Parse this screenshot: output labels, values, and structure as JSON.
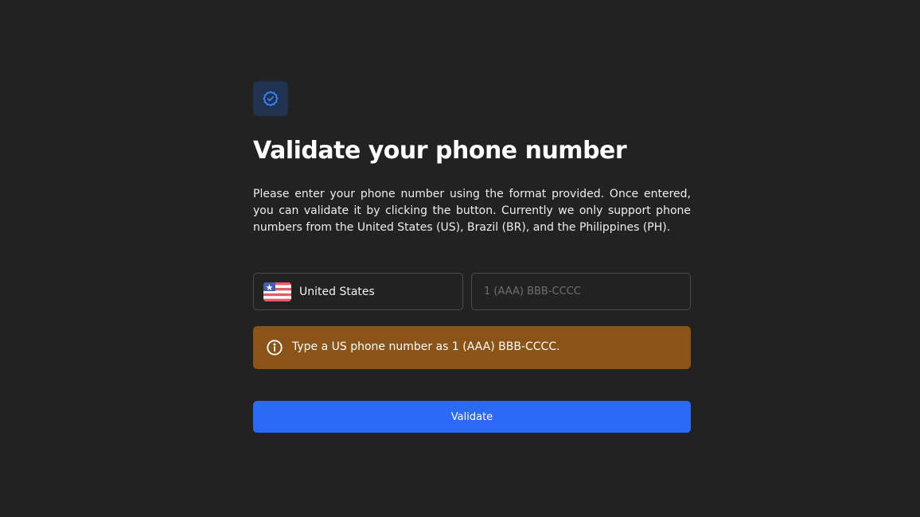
{
  "header": {
    "icon": "verified-badge-icon",
    "title": "Validate your phone number",
    "description": "Please enter your phone number using the format provided. Once entered, you can validate it by clicking the button. Currently we only support phone numbers from the United States (US), Brazil (BR), and the Philippines (PH)."
  },
  "form": {
    "country": {
      "selected_label": "United States",
      "flag_icon": "us-flag-icon"
    },
    "phone": {
      "value": "",
      "placeholder": "1 (AAA) BBB-CCCC"
    },
    "alert": {
      "icon": "info-circle-icon",
      "text": "Type a US phone number as 1 (AAA) BBB-CCCC.",
      "color": "#8a5317"
    },
    "submit_label": "Validate"
  },
  "colors": {
    "background": "#222222",
    "accent": "#2b6af7",
    "badge_bg": "#1f3350",
    "badge_icon": "#3b82f6"
  }
}
